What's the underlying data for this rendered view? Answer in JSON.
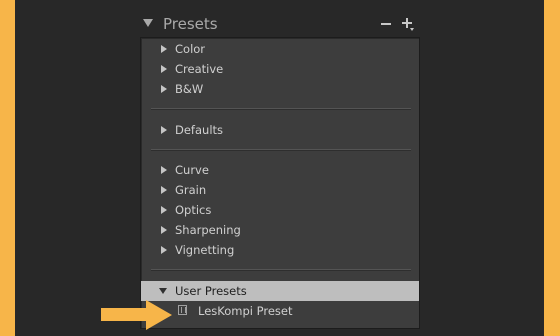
{
  "panel": {
    "title": "Presets",
    "add_icon": "plus-icon",
    "remove_icon": "minus-icon"
  },
  "groups": {
    "g1": [
      "Color",
      "Creative",
      "B&W"
    ],
    "g2": [
      "Defaults"
    ],
    "g3": [
      "Curve",
      "Grain",
      "Optics",
      "Sharpening",
      "Vignetting"
    ]
  },
  "user_presets": {
    "label": "User Presets",
    "items": [
      "LesKompi Preset"
    ]
  },
  "colors": {
    "frame": "#f7b549",
    "background": "#282828",
    "panel": "#3d3d3d",
    "highlight": "#bebebe"
  }
}
